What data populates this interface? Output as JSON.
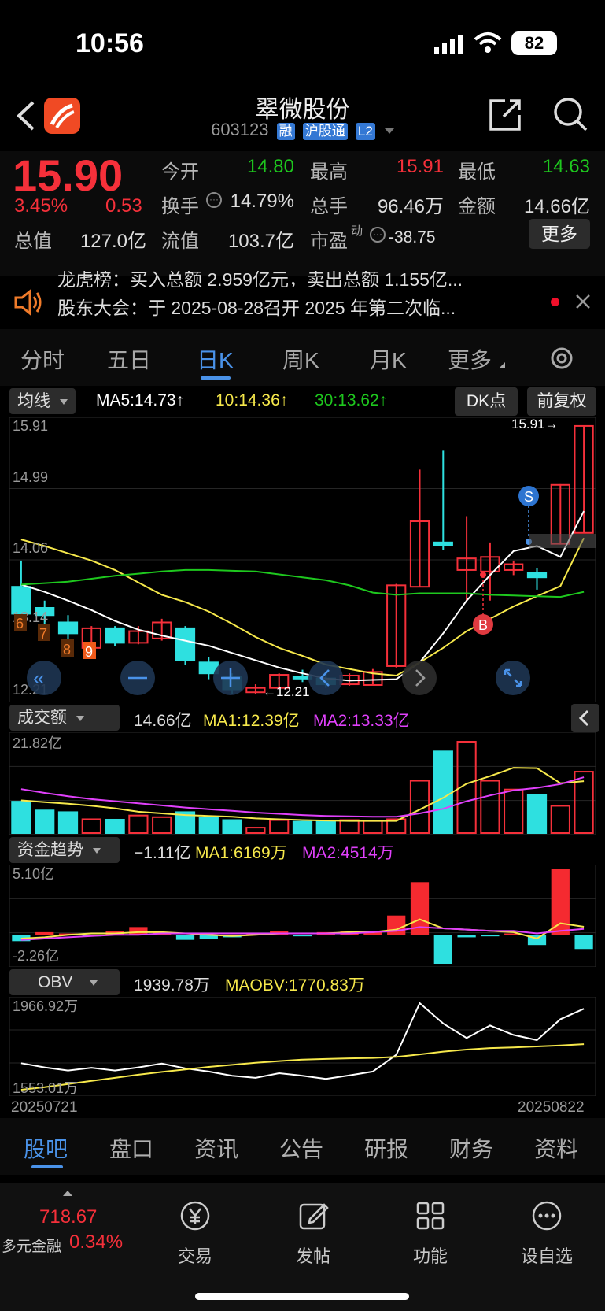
{
  "status": {
    "time": "10:56",
    "battery": "82"
  },
  "header": {
    "title": "翠微股份",
    "code": "603123",
    "tags": [
      "融",
      "沪股通",
      "L2"
    ]
  },
  "quote": {
    "price": "15.90",
    "pct": "3.45%",
    "chg": "0.53",
    "open_label": "今开",
    "open": "14.80",
    "high_label": "最高",
    "high": "15.91",
    "low_label": "最低",
    "low": "14.63",
    "turnover_label": "换手",
    "turnover": "14.79%",
    "volume_label": "总手",
    "volume": "96.46万",
    "amount_label": "金额",
    "amount": "14.66亿",
    "mktcap_label": "总值",
    "mktcap": "127.0亿",
    "float_label": "流值",
    "float_cap": "103.7亿",
    "pe_label": "市盈",
    "pe_sup": "动",
    "pe": "-38.75",
    "more_button": "更多"
  },
  "news": {
    "line1": "龙虎榜：买入总额 2.959亿元，卖出总额 1.155亿...",
    "line2": "股东大会：于 2025-08-28召开 2025 年第二次临..."
  },
  "tabs": [
    "分时",
    "五日",
    "日K",
    "周K",
    "月K",
    "更多"
  ],
  "active_tab": "日K",
  "kline_bar": {
    "selector": "均线",
    "ma5": "MA5:14.73↑",
    "ma10": "10:14.36↑",
    "ma30": "30:13.62↑",
    "dk_button": "DK点",
    "adjust_button": "前复权"
  },
  "kline_axis": {
    "y1": "15.91",
    "y2": "14.99",
    "y3": "14.06",
    "y4": "13.14",
    "y5": "12.21",
    "max_label": "15.91→",
    "min_label": "←12.21",
    "signal_s": "S",
    "signal_b": "B",
    "count_6": "6",
    "count_7": "7",
    "count_8": "8",
    "count_9": "9"
  },
  "volume_bar": {
    "selector": "成交额",
    "value": "14.66亿",
    "ma1": "MA1:12.39亿",
    "ma2": "MA2:13.33亿",
    "axis_top": "21.82亿"
  },
  "fund_bar": {
    "selector": "资金趋势",
    "value": "−1.11亿",
    "ma1": "MA1:6169万",
    "ma2": "MA2:4514万",
    "axis_top": "5.10亿",
    "axis_bottom": "-2.26亿"
  },
  "obv_bar": {
    "selector": "OBV",
    "value": "1939.78万",
    "maobv": "MAOBV:1770.83万",
    "axis_top": "1966.92万",
    "axis_bottom": "1553.01万"
  },
  "dates": {
    "start": "20250721",
    "end": "20250822"
  },
  "bottom_tabs": [
    "股吧",
    "盘口",
    "资讯",
    "公告",
    "研报",
    "财务",
    "资料"
  ],
  "dock": {
    "index_value": "718.67",
    "index_name": "多元金融",
    "index_pct": "0.34%",
    "items": [
      "交易",
      "发帖",
      "功能",
      "设自选"
    ]
  },
  "colors": {
    "up": "#f5303a",
    "down": "#2ee0e0",
    "ma5": "#ffffff",
    "ma10": "#f6e84b",
    "ma30": "#1ec81e",
    "accent": "#4a92e8"
  },
  "chart_data": {
    "type": "candlestick",
    "ylim": [
      12.21,
      15.91
    ],
    "candles": [
      {
        "open": 13.69,
        "close": 13.32,
        "high": 14.05,
        "low": 13.25
      },
      {
        "open": 13.4,
        "close": 13.3,
        "high": 13.5,
        "low": 13.1
      },
      {
        "open": 13.2,
        "close": 13.05,
        "high": 13.3,
        "low": 12.9
      },
      {
        "open": 12.85,
        "close": 13.12,
        "high": 13.15,
        "low": 12.85
      },
      {
        "open": 13.12,
        "close": 12.92,
        "high": 13.15,
        "low": 12.88
      },
      {
        "open": 12.92,
        "close": 13.08,
        "high": 13.15,
        "low": 12.9
      },
      {
        "open": 12.98,
        "close": 13.2,
        "high": 13.25,
        "low": 12.95
      },
      {
        "open": 13.12,
        "close": 12.68,
        "high": 13.15,
        "low": 12.62
      },
      {
        "open": 12.65,
        "close": 12.5,
        "high": 12.72,
        "low": 12.42
      },
      {
        "open": 12.45,
        "close": 12.28,
        "high": 12.5,
        "low": 12.21
      },
      {
        "open": 12.24,
        "close": 12.3,
        "high": 12.35,
        "low": 12.21
      },
      {
        "open": 12.3,
        "close": 12.48,
        "high": 12.5,
        "low": 12.28
      },
      {
        "open": 12.45,
        "close": 12.43,
        "high": 12.55,
        "low": 12.38
      },
      {
        "open": 12.43,
        "close": 12.35,
        "high": 12.5,
        "low": 12.3
      },
      {
        "open": 12.35,
        "close": 12.47,
        "high": 12.5,
        "low": 12.33
      },
      {
        "open": 12.34,
        "close": 12.52,
        "high": 12.56,
        "low": 12.34
      },
      {
        "open": 12.6,
        "close": 13.71,
        "high": 13.73,
        "low": 12.58
      },
      {
        "open": 13.69,
        "close": 14.59,
        "high": 15.3,
        "low": 13.69
      },
      {
        "open": 14.3,
        "close": 14.26,
        "high": 15.56,
        "low": 14.2
      },
      {
        "open": 13.92,
        "close": 14.08,
        "high": 14.66,
        "low": 13.5
      },
      {
        "open": 13.9,
        "close": 14.1,
        "high": 14.3,
        "low": 13.5
      },
      {
        "open": 13.92,
        "close": 14.0,
        "high": 14.05,
        "low": 13.85
      },
      {
        "open": 13.88,
        "close": 13.82,
        "high": 13.95,
        "low": 13.65
      },
      {
        "open": 14.28,
        "close": 15.09,
        "high": 15.1,
        "low": 14.27
      },
      {
        "open": 14.43,
        "close": 15.9,
        "high": 15.91,
        "low": 14.43
      }
    ],
    "series": [
      {
        "name": "MA5",
        "values": [
          13.72,
          13.62,
          13.5,
          13.37,
          13.22,
          13.1,
          13.02,
          12.95,
          12.88,
          12.78,
          12.68,
          12.58,
          12.5,
          12.43,
          12.4,
          12.41,
          12.42,
          12.65,
          13.05,
          13.5,
          13.85,
          14.18,
          14.25,
          14.1,
          14.73
        ]
      },
      {
        "name": "10",
        "values": [
          14.34,
          14.25,
          14.15,
          14.05,
          13.92,
          13.75,
          13.58,
          13.48,
          13.35,
          13.18,
          13.0,
          12.85,
          12.74,
          12.62,
          12.56,
          12.5,
          12.47,
          12.65,
          12.85,
          13.08,
          13.25,
          13.42,
          13.56,
          13.7,
          14.36
        ]
      },
      {
        "name": "30",
        "values": [
          13.72,
          13.74,
          13.76,
          13.8,
          13.84,
          13.87,
          13.9,
          13.92,
          13.92,
          13.91,
          13.9,
          13.86,
          13.82,
          13.78,
          13.71,
          13.61,
          13.58,
          13.6,
          13.6,
          13.6,
          13.58,
          13.57,
          13.56,
          13.55,
          13.62
        ]
      }
    ],
    "volume": [
      7.5,
      5.4,
      5.0,
      3.3,
      3.2,
      4.2,
      3.8,
      5.0,
      3.7,
      3.1,
      1.3,
      3.1,
      2.7,
      3.0,
      3.1,
      2.9,
      3.3,
      12.5,
      19.5,
      21.82,
      12.5,
      10.4,
      9.2,
      6.5,
      14.66
    ],
    "volume_ma1": [
      7.8,
      7.4,
      7.0,
      6.5,
      5.9,
      5.1,
      4.7,
      4.3,
      4.1,
      3.9,
      3.5,
      3.3,
      3.1,
      3.0,
      2.9,
      2.9,
      2.9,
      5.6,
      8.4,
      11.8,
      13.6,
      15.6,
      15.5,
      11.9,
      12.39
    ],
    "volume_ma2": [
      10.5,
      9.6,
      8.8,
      8.1,
      7.6,
      7.1,
      6.6,
      6.1,
      5.7,
      5.3,
      4.9,
      4.6,
      4.3,
      4.1,
      4.0,
      3.9,
      3.9,
      4.7,
      5.8,
      7.6,
      9.0,
      10.2,
      10.8,
      11.7,
      13.33
    ],
    "fund": [
      -0.5,
      0.2,
      0.1,
      -0.1,
      0.3,
      0.6,
      0.2,
      -0.4,
      -0.3,
      -0.2,
      0.1,
      0.3,
      -0.1,
      0.2,
      0.3,
      0.3,
      1.5,
      4.1,
      -2.26,
      -0.2,
      -0.1,
      0.1,
      -0.8,
      5.1,
      -1.11
    ],
    "fund_ma1": [
      -0.3,
      -0.2,
      0.0,
      0.1,
      0.1,
      0.2,
      0.2,
      0.1,
      0.0,
      -0.1,
      0.0,
      0.1,
      0.1,
      0.1,
      0.2,
      0.2,
      0.4,
      1.2,
      0.5,
      0.4,
      0.3,
      0.2,
      -0.3,
      0.9,
      0.62
    ],
    "fund_ma2": [
      -0.4,
      -0.3,
      -0.2,
      -0.1,
      0.0,
      0.0,
      0.1,
      0.1,
      0.1,
      0.1,
      0.1,
      0.1,
      0.1,
      0.1,
      0.1,
      0.2,
      0.3,
      0.6,
      0.5,
      0.4,
      0.3,
      0.3,
      0.1,
      0.3,
      0.45
    ],
    "obv": [
      1680,
      1660,
      1645,
      1658,
      1645,
      1660,
      1678,
      1655,
      1640,
      1620,
      1610,
      1632,
      1620,
      1605,
      1622,
      1640,
      1720,
      1966.92,
      1870,
      1800,
      1860,
      1815,
      1790,
      1890,
      1939.78
    ],
    "maobv": [
      1553.01,
      1565,
      1580,
      1595,
      1610,
      1625,
      1638,
      1650,
      1662,
      1672,
      1682,
      1690,
      1697,
      1700,
      1703,
      1705,
      1710,
      1722,
      1735,
      1745,
      1752,
      1755,
      1760,
      1765,
      1770.83
    ]
  }
}
